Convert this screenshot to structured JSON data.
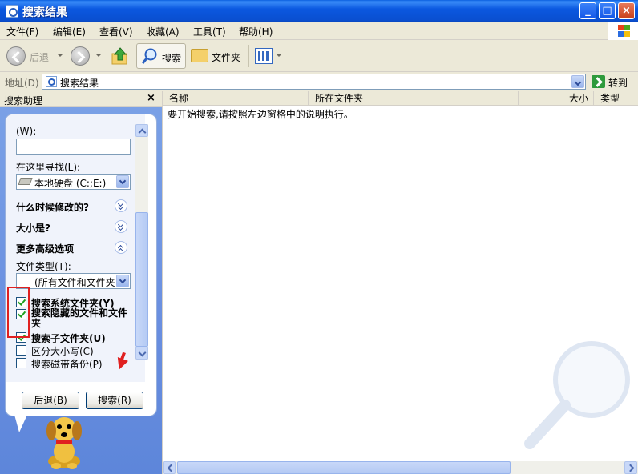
{
  "window": {
    "title": "搜索结果"
  },
  "menu": {
    "file": "文件(F)",
    "edit": "编辑(E)",
    "view": "查看(V)",
    "favorites": "收藏(A)",
    "tools": "工具(T)",
    "help": "帮助(H)"
  },
  "toolbar": {
    "back": "后退",
    "search": "搜索",
    "folders": "文件夹"
  },
  "address": {
    "label": "地址(D)",
    "value": "搜索结果",
    "go": "转到"
  },
  "assistant": {
    "title": "搜索助理",
    "close": "×",
    "word_label": "(W):",
    "word_value": "",
    "look_in_label": "在这里寻找(L):",
    "look_in_value": "本地硬盘 (C:;E:)",
    "when_modified": "什么时候修改的?",
    "size": "大小是?",
    "more_options": "更多高级选项",
    "file_type_label": "文件类型(T):",
    "file_type_value": "(所有文件和文件夹)",
    "checkboxes": [
      {
        "label": "搜索系统文件夹(Y)",
        "checked": true
      },
      {
        "label": "搜索隐藏的文件和文件夹",
        "checked": true
      },
      {
        "label": "搜索子文件夹(U)",
        "checked": true
      },
      {
        "label": "区分大小写(C)",
        "checked": false
      },
      {
        "label": "搜索磁带备份(P)",
        "checked": false
      }
    ],
    "back_button": "后退(B)",
    "search_button": "搜索(R)"
  },
  "results": {
    "columns": [
      "名称",
      "所在文件夹",
      "大小",
      "类型"
    ],
    "hint": "要开始搜索,请按照左边窗格中的说明执行。"
  },
  "colors": {
    "titlebar": "#0A4FD0",
    "pane": "#6A8FE0",
    "highlight": "#E02020"
  }
}
